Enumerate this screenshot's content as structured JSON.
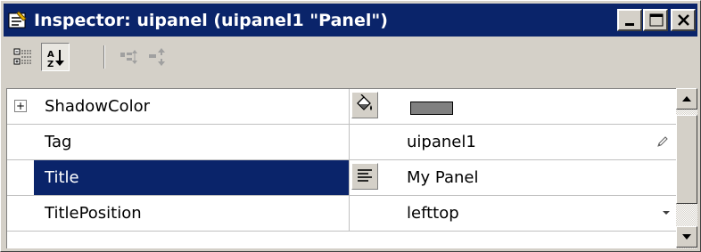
{
  "window": {
    "title": "Inspector: uipanel (uipanel1 \"Panel\")",
    "icon": "inspector-app-icon",
    "controls": [
      "minimize-icon",
      "maximize-icon",
      "close-icon"
    ]
  },
  "toolbar": {
    "items": [
      {
        "name": "categorized-view",
        "icon": "categorized-list-icon",
        "pressed": false
      },
      {
        "name": "alphabetical-sort",
        "icon": "sort-az-icon",
        "pressed": true
      },
      {
        "name": "show-events",
        "icon": "tree-expand-icon",
        "pressed": false
      },
      {
        "name": "show-properties",
        "icon": "tree-collapse-icon",
        "pressed": false
      }
    ]
  },
  "grid": {
    "rows": [
      {
        "name": "ShadowColor",
        "value": "",
        "expandable": true,
        "expander_symbol": "+",
        "editor": "paint-bucket-icon",
        "color_swatch": "#808080"
      },
      {
        "name": "Tag",
        "value": "uipanel1",
        "expandable": false,
        "editor": "",
        "trailing": "pencil-icon"
      },
      {
        "name": "Title",
        "value": "My Panel",
        "expandable": false,
        "editor": "text-lines-icon",
        "selected": true
      },
      {
        "name": "TitlePosition",
        "value": "lefttop",
        "expandable": false,
        "editor": "",
        "trailing": "dropdown-arrow-icon"
      }
    ]
  },
  "colors": {
    "titlebar": "#0a246a",
    "selection": "#0a246a",
    "face": "#d4d0c8"
  }
}
